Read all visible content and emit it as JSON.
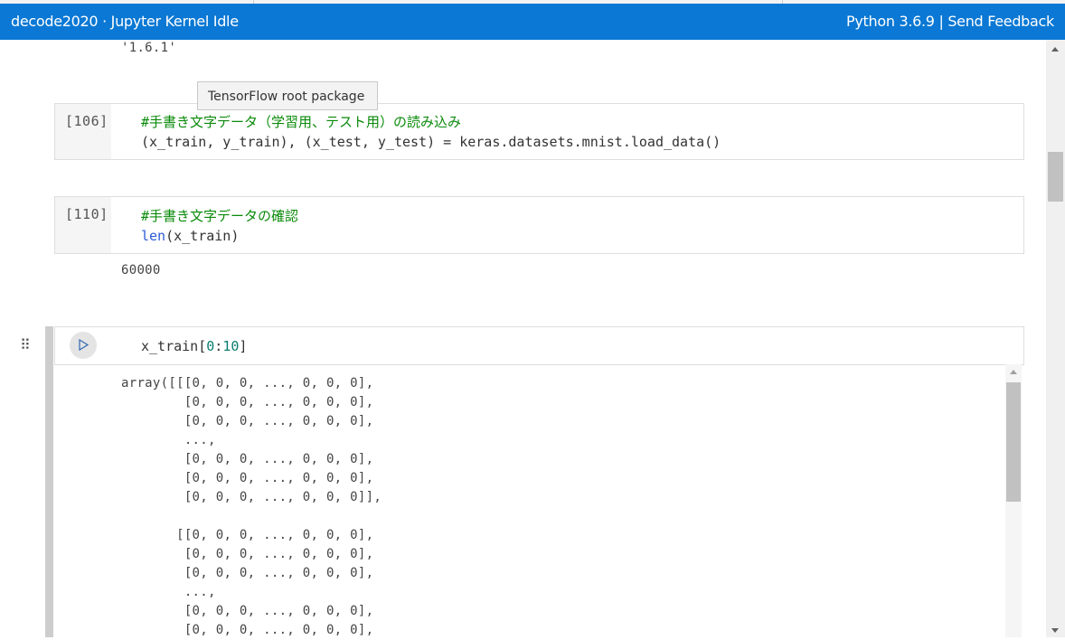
{
  "statusbar": {
    "left_text": "decode2020 · Jupyter Kernel Idle",
    "right_text": "Python 3.6.9 |  Send Feedback",
    "color": "#0a78d4"
  },
  "outputs": {
    "version": "'1.6.1'",
    "len_result": "60000"
  },
  "tooltip": {
    "text": "TensorFlow root package"
  },
  "cells": [
    {
      "prompt": "[106]",
      "comment": "#手書き文字データ（学習用、テスト用）の読み込み",
      "code": "(x_train, y_train), (x_test, y_test) = keras.datasets.mnist.load_data()"
    },
    {
      "prompt": "[110]",
      "comment": "#手書き文字データの確認",
      "code_fn": "len",
      "code_rest": "(x_train)"
    },
    {
      "code_pre": "x_train[",
      "code_num1": "0",
      "code_colon": ":",
      "code_num2": "10",
      "code_post": "]"
    }
  ],
  "array_output": [
    "array([[[0, 0, 0, ..., 0, 0, 0],",
    "        [0, 0, 0, ..., 0, 0, 0],",
    "        [0, 0, 0, ..., 0, 0, 0],",
    "        ...,",
    "        [0, 0, 0, ..., 0, 0, 0],",
    "        [0, 0, 0, ..., 0, 0, 0],",
    "        [0, 0, 0, ..., 0, 0, 0]],",
    "",
    "       [[0, 0, 0, ..., 0, 0, 0],",
    "        [0, 0, 0, ..., 0, 0, 0],",
    "        [0, 0, 0, ..., 0, 0, 0],",
    "        ...,",
    "        [0, 0, 0, ..., 0, 0, 0],",
    "        [0, 0, 0, ..., 0, 0, 0],"
  ],
  "icons": {
    "drag": "drag-handle-icon",
    "run": "run-cell-icon",
    "scroll_up": "scroll-up-arrow-icon",
    "scroll_down": "scroll-down-arrow-icon"
  }
}
